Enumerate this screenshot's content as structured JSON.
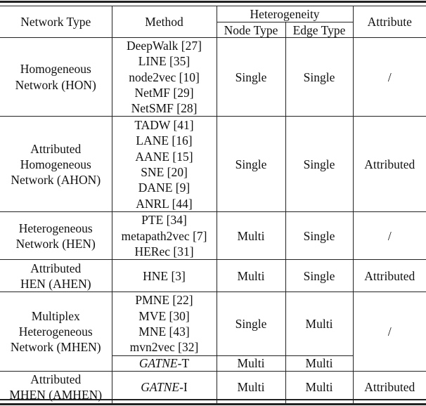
{
  "table": {
    "headers": {
      "network_type": "Network Type",
      "method": "Method",
      "heterogeneity": "Heterogeneity",
      "node_type": "Node Type",
      "edge_type": "Edge Type",
      "attribute": "Attribute"
    },
    "rows": [
      {
        "network_type": [
          "Homogeneous",
          "Network (HON)"
        ],
        "methods": [
          "DeepWalk [27]",
          "LINE [35]",
          "node2vec [10]",
          "NetMF [29]",
          "NetSMF [28]"
        ],
        "node_type": "Single",
        "edge_type": "Single",
        "attribute": "/"
      },
      {
        "network_type": [
          "Attributed",
          "Homogeneous",
          "Network (AHON)"
        ],
        "methods": [
          "TADW [41]",
          "LANE [16]",
          "AANE [15]",
          "SNE [20]",
          "DANE [9]",
          "ANRL [44]"
        ],
        "node_type": "Single",
        "edge_type": "Single",
        "attribute": "Attributed"
      },
      {
        "network_type": [
          "Heterogeneous",
          "Network (HEN)"
        ],
        "methods": [
          "PTE [34]",
          "metapath2vec [7]",
          "HERec [31]"
        ],
        "node_type": "Multi",
        "edge_type": "Single",
        "attribute": "/"
      },
      {
        "network_type": [
          "Attributed",
          "HEN (AHEN)"
        ],
        "methods": [
          "HNE [3]"
        ],
        "node_type": "Multi",
        "edge_type": "Single",
        "attribute": "Attributed"
      },
      {
        "network_type": [
          "Multiplex",
          "Heterogeneous",
          "Network (MHEN)"
        ],
        "methods": [
          "PMNE [22]",
          "MVE [30]",
          "MNE [43]",
          "mvn2vec [32]"
        ],
        "node_type": "Single",
        "edge_type": "Multi",
        "attribute": "/",
        "sub_row": {
          "method_italic": "GATNE",
          "method_suffix": "-T",
          "node_type": "Multi",
          "edge_type": "Multi"
        }
      },
      {
        "network_type": [
          "Attributed",
          "MHEN (AMHEN)"
        ],
        "method_italic": "GATNE",
        "method_suffix": "-I",
        "node_type": "Multi",
        "edge_type": "Multi",
        "attribute": "Attributed"
      }
    ]
  }
}
